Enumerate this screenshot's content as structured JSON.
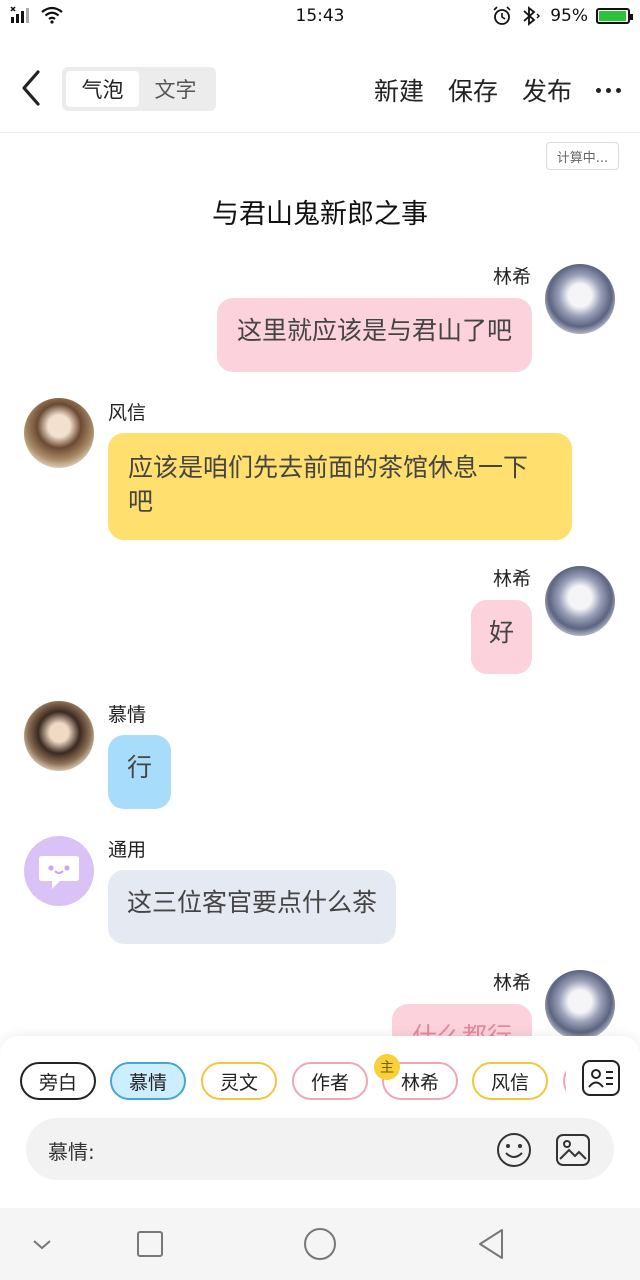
{
  "status_bar": {
    "carrier_icons": "x-signal-icon",
    "time": "15:43",
    "battery_percent": "95%",
    "battery_level": 0.95
  },
  "top_bar": {
    "segment": [
      "气泡",
      "文字"
    ],
    "segment_active": "气泡",
    "actions": [
      "新建",
      "保存",
      "发布"
    ]
  },
  "calc_badge": "计算中...",
  "story_title": "与君山鬼新郎之事",
  "messages": [
    {
      "side": "right",
      "name": "林希",
      "text": "这里就应该是与君山了吧",
      "color": "pink"
    },
    {
      "side": "left",
      "name": "风信",
      "text": "应该是咱们先去前面的茶馆休息一下吧",
      "color": "yellow"
    },
    {
      "side": "right",
      "name": "林希",
      "text": "好",
      "color": "pink"
    },
    {
      "side": "left",
      "name": "慕情",
      "text": "行",
      "color": "blue"
    },
    {
      "side": "left",
      "name": "通用",
      "text": "这三位客官要点什么茶",
      "color": "gray"
    },
    {
      "side": "right",
      "name": "林希",
      "text": "什么都行",
      "color": "pink"
    }
  ],
  "role_chips": [
    "旁白",
    "慕情",
    "灵文",
    "作者",
    "林希",
    "风信"
  ],
  "selected_role": "慕情",
  "main_badge": "主",
  "input": {
    "speaker_label": "慕情:"
  },
  "colors": {
    "pink": "#fcd2dc",
    "yellow": "#ffdf6e",
    "blue": "#a8dcfb",
    "gray": "#e5e9f1",
    "battery_green": "#29c43a"
  }
}
